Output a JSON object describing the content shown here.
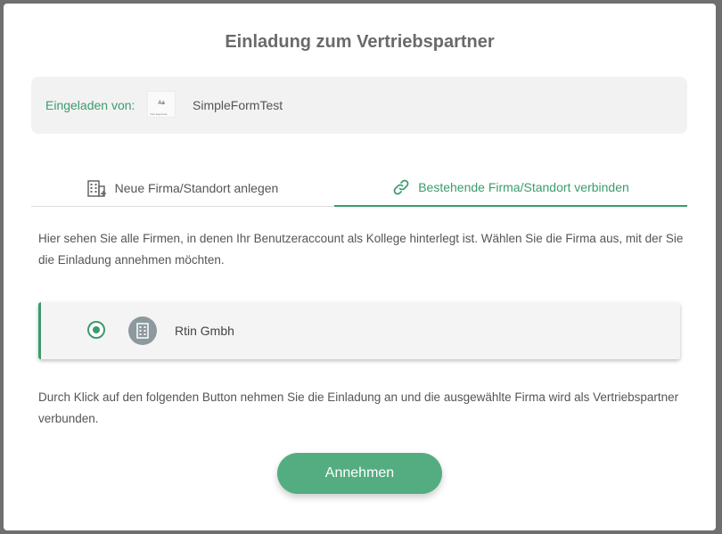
{
  "dialog": {
    "title": "Einladung zum Vertriebspartner"
  },
  "inviter": {
    "label": "Eingeladen von:",
    "logo_text": "Aa",
    "logo_subtext": "Your logo here",
    "name": "SimpleFormTest"
  },
  "tabs": [
    {
      "label": "Neue Firma/Standort anlegen",
      "icon": "building-add-icon",
      "active": false
    },
    {
      "label": "Bestehende Firma/Standort verbinden",
      "icon": "link-icon",
      "active": true
    }
  ],
  "description": "Hier sehen Sie alle Firmen, in denen Ihr Benutzeraccount als Kollege hinterlegt ist. Wählen Sie die Firma aus, mit der Sie die Einladung annehmen möchten.",
  "companies": [
    {
      "name": "Rtin Gmbh",
      "selected": true,
      "icon": "building-icon"
    }
  ],
  "footer_text": "Durch Klick auf den folgenden Button nehmen Sie die Einladung an und die ausgewählte Firma wird als Vertriebspartner verbunden.",
  "accept_button": {
    "label": "Annehmen"
  },
  "colors": {
    "accent": "#3d9a6e",
    "button": "#53ad80",
    "panel": "#f2f2f2",
    "icon_bg": "#8c999e"
  }
}
